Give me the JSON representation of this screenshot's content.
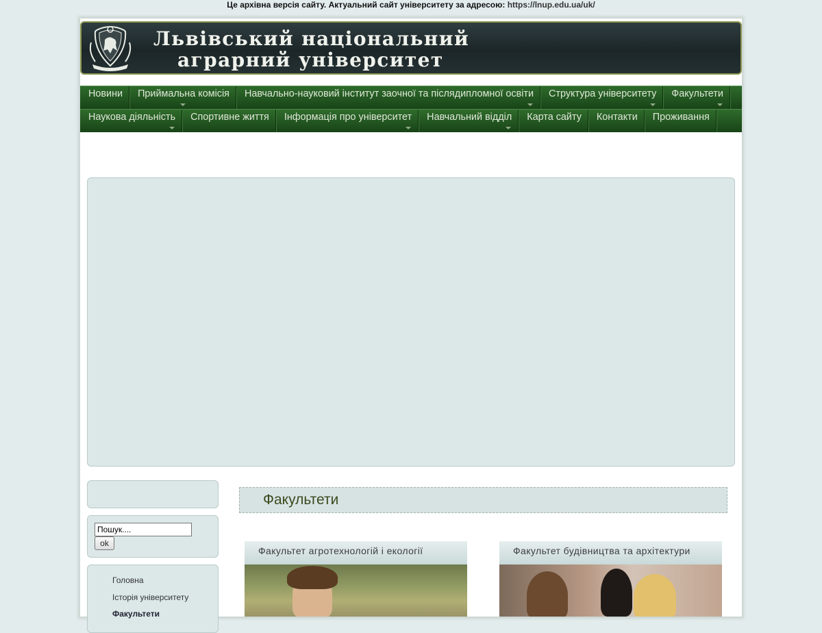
{
  "notice": {
    "text": "Це архівна версія сайту. Актуальний сайт університету за адресою:",
    "link": "https://lnup.edu.ua/uk/"
  },
  "header": {
    "title_line1": "Львівський національний",
    "title_line2": "аграрний університет"
  },
  "nav": {
    "row1": [
      {
        "label": "Новини",
        "has_sub": false
      },
      {
        "label": "Приймальна комісія",
        "has_sub": true
      },
      {
        "label": "Навчально-науковий інститут заочної та післядипломної освіти",
        "has_sub": true
      },
      {
        "label": "Структура університету",
        "has_sub": true
      },
      {
        "label": "Факультети",
        "has_sub": true
      }
    ],
    "row2": [
      {
        "label": "Наукова діяльність",
        "has_sub": true
      },
      {
        "label": "Спортивне життя",
        "has_sub": false
      },
      {
        "label": "Інформація про університет",
        "has_sub": true
      },
      {
        "label": "Навчальний відділ",
        "has_sub": true
      },
      {
        "label": "Карта сайту",
        "has_sub": false
      },
      {
        "label": "Контакти",
        "has_sub": false
      },
      {
        "label": "Проживання",
        "has_sub": false
      }
    ]
  },
  "search": {
    "value": "Пошук....",
    "button": "ok"
  },
  "side_menu": {
    "items": [
      {
        "label": "Головна",
        "active": false
      },
      {
        "label": "Історія університету",
        "active": false
      },
      {
        "label": "Факультети",
        "active": true
      }
    ]
  },
  "content": {
    "title": "Факультети",
    "faculties": [
      {
        "name": "Факультет агротехнологій і екології"
      },
      {
        "name": "Факультет будівництва та архітектури"
      }
    ]
  },
  "colors": {
    "nav_green": "#1f5a1d",
    "header_dark": "#1c2628",
    "header_border": "#8e9a53",
    "panel": "#dce8e8"
  }
}
